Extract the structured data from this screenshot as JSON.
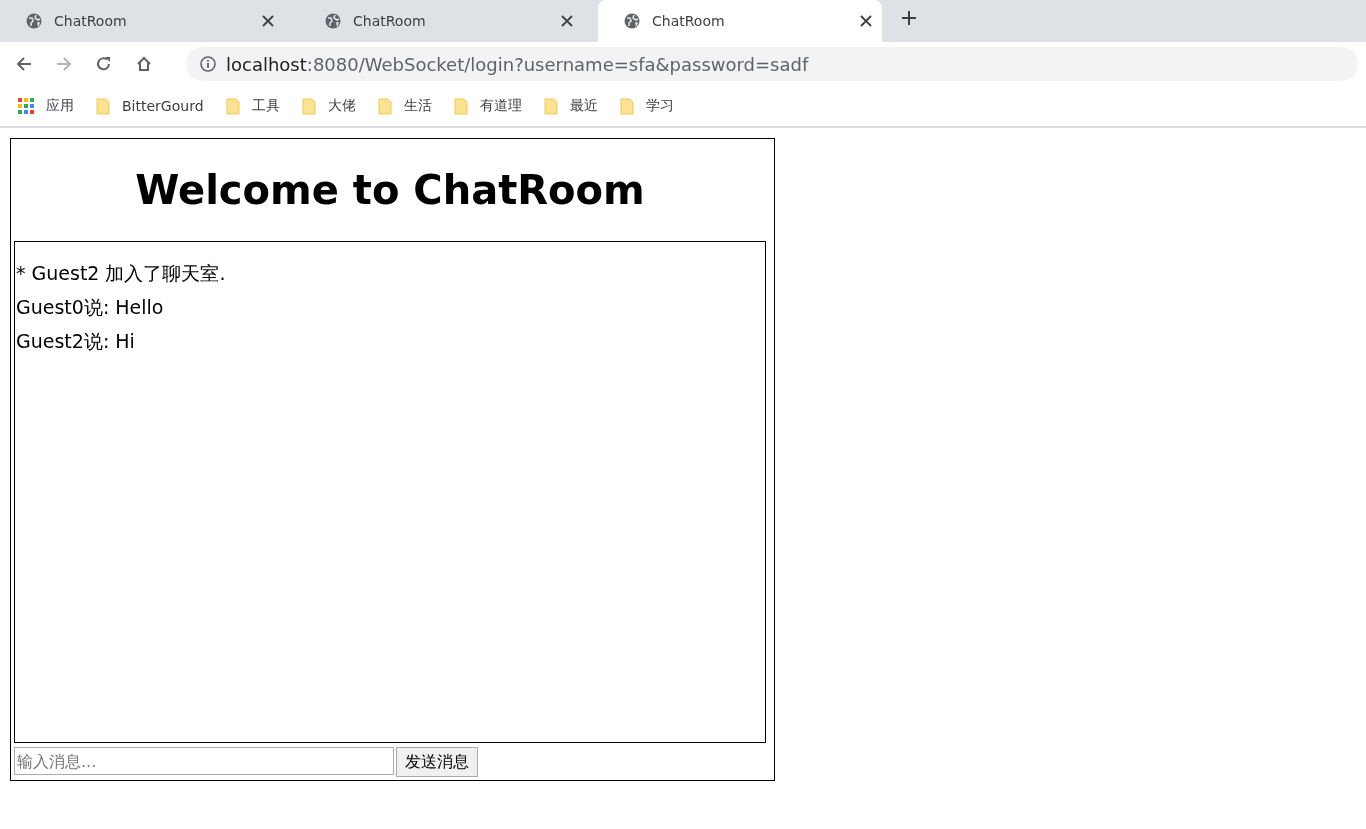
{
  "tabs": [
    {
      "title": "ChatRoom",
      "selected": false
    },
    {
      "title": "ChatRoom",
      "selected": false
    },
    {
      "title": "ChatRoom",
      "selected": true
    }
  ],
  "address_bar": {
    "host": "localhost",
    "rest": ":8080/WebSocket/login?username=sfa&password=sadf"
  },
  "bookmarks": [
    {
      "kind": "apps",
      "label": "应用"
    },
    {
      "kind": "folder",
      "label": "BitterGourd"
    },
    {
      "kind": "folder",
      "label": "工具"
    },
    {
      "kind": "folder",
      "label": "大佬"
    },
    {
      "kind": "folder",
      "label": "生活"
    },
    {
      "kind": "folder",
      "label": "有道理"
    },
    {
      "kind": "folder",
      "label": "最近"
    },
    {
      "kind": "folder",
      "label": "学习"
    }
  ],
  "page": {
    "heading": "Welcome to ChatRoom",
    "messages": [
      "* Guest2 加入了聊天室.",
      "Guest0说: Hello",
      "Guest2说: Hi"
    ],
    "message_input": {
      "placeholder": "输入消息..."
    },
    "send_button": "发送消息"
  }
}
